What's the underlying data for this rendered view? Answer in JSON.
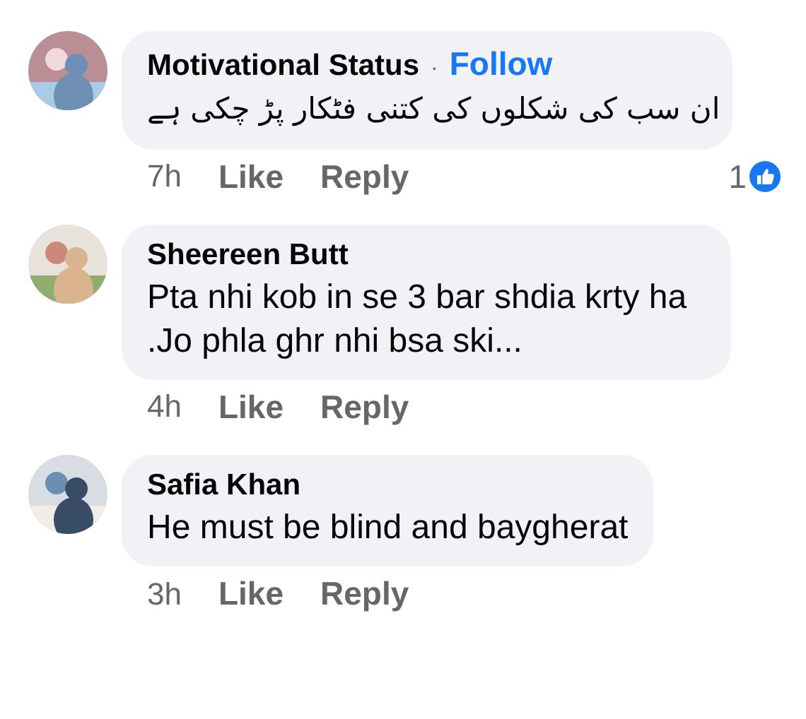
{
  "comments": [
    {
      "author": "Motivational Status",
      "follow": {
        "separator": "·",
        "label": "Follow"
      },
      "text": "ان سب کی شکلوں کی کتنی فٹکار پڑ چکی ہے",
      "rtl": true,
      "time": "7h",
      "like": "Like",
      "reply": "Reply",
      "reactions": "1"
    },
    {
      "author": "Sheereen Butt",
      "text": "Pta nhi kob in se 3 bar shdia krty ha .Jo phla ghr nhi bsa ski...",
      "rtl": false,
      "time": "4h",
      "like": "Like",
      "reply": "Reply"
    },
    {
      "author": "Safia Khan",
      "text": "He must be blind and baygherat",
      "rtl": false,
      "time": "3h",
      "like": "Like",
      "reply": "Reply"
    }
  ]
}
